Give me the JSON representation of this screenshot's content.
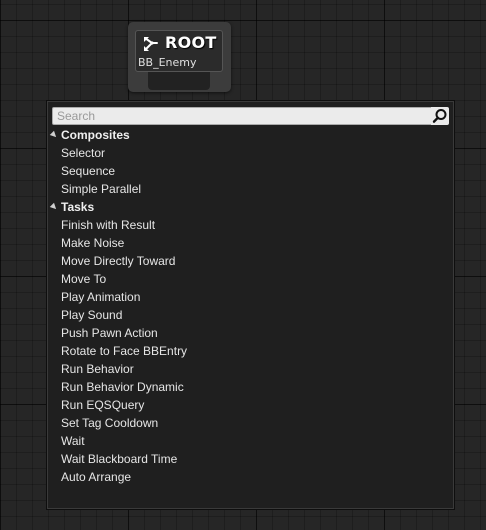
{
  "root_node": {
    "title": "ROOT",
    "subtitle": "BB_Enemy",
    "icon": "tree-branch-icon"
  },
  "menu": {
    "search_placeholder": "Search",
    "search_icon": "search-icon",
    "categories": [
      {
        "label": "Composites",
        "expanded": true,
        "items": [
          "Selector",
          "Sequence",
          "Simple Parallel"
        ]
      },
      {
        "label": "Tasks",
        "expanded": true,
        "items": [
          "Finish with Result",
          "Make Noise",
          "Move Directly Toward",
          "Move To",
          "Play Animation",
          "Play Sound",
          "Push Pawn Action",
          "Rotate to Face BBEntry",
          "Run Behavior",
          "Run Behavior Dynamic",
          "Run EQSQuery",
          "Set Tag Cooldown",
          "Wait",
          "Wait Blackboard Time"
        ]
      }
    ],
    "extra_items": [
      "Auto Arrange"
    ]
  },
  "colors": {
    "graph_background": "#262626",
    "node_body": "#3c3c3c",
    "menu_background": "#1f1f1f",
    "text": "#e6e6e6"
  }
}
